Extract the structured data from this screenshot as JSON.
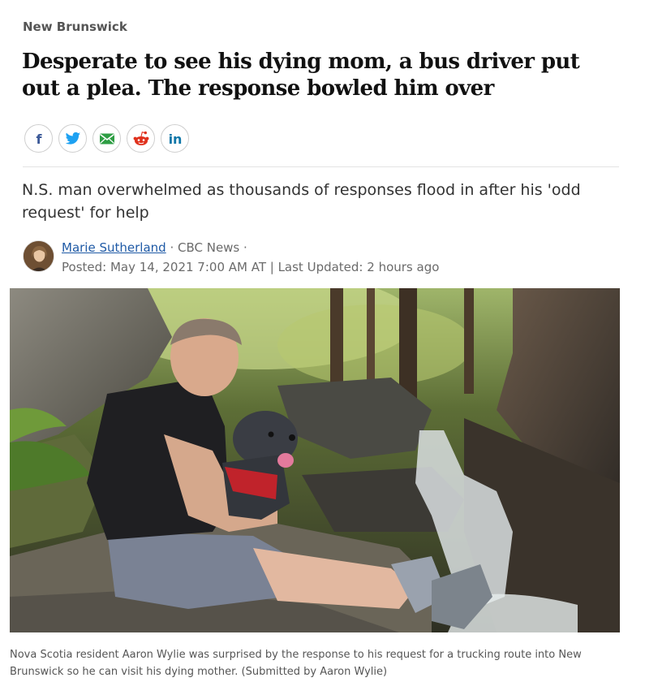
{
  "section": "New Brunswick",
  "headline": "Desperate to see his dying mom, a bus driver put out a plea. The response bowled him over",
  "share": {
    "buttons": [
      {
        "icon": "facebook-icon",
        "glyph": "f",
        "color": "#3b5998"
      },
      {
        "icon": "twitter-icon",
        "glyph": "",
        "color": "#1da1f2"
      },
      {
        "icon": "email-icon",
        "glyph": "",
        "color": "#2e9e44"
      },
      {
        "icon": "reddit-icon",
        "glyph": "",
        "color": "#e0311d"
      },
      {
        "icon": "linkedin-icon",
        "glyph": "in",
        "color": "#0e76a8"
      }
    ]
  },
  "deck": "N.S. man overwhelmed as thousands of responses flood in after his 'odd request' for help",
  "byline": {
    "author": "Marie Sutherland",
    "outlet": " · CBC News ·",
    "dates": "Posted: May 14, 2021 7:00 AM AT | Last Updated: 2 hours ago"
  },
  "caption": "Nova Scotia resident Aaron Wylie was surprised by the response to his request for a trucking route into New Brunswick so he can visit his dying mother. (Submitted by Aaron Wylie)",
  "colors": {
    "link": "#1f5aa6",
    "headline": "#111111",
    "muted": "#6b6b6b"
  }
}
